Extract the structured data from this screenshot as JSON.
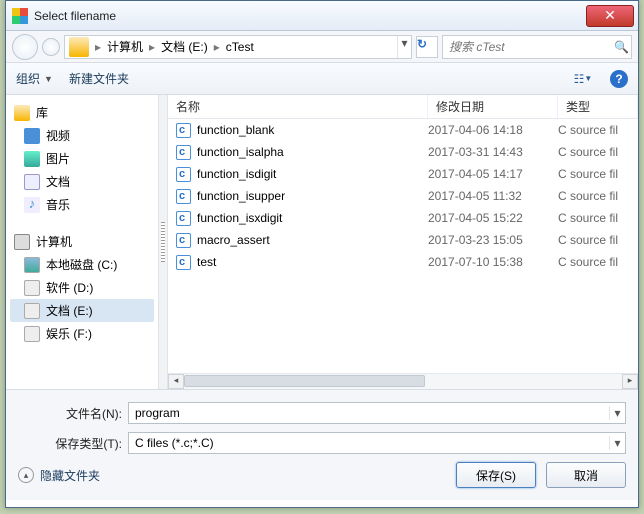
{
  "title": "Select filename",
  "breadcrumb": {
    "seg1": "计算机",
    "seg2": "文档 (E:)",
    "seg3": "cTest"
  },
  "search_placeholder": "搜索 cTest",
  "toolbar": {
    "organize": "组织",
    "newfolder": "新建文件夹"
  },
  "sidebar": {
    "lib": "库",
    "video": "视频",
    "pic": "图片",
    "doc": "文档",
    "music": "音乐",
    "pc": "计算机",
    "drive_c": "本地磁盘 (C:)",
    "drive_d": "软件 (D:)",
    "drive_e": "文档 (E:)",
    "drive_f": "娱乐 (F:)"
  },
  "columns": {
    "name": "名称",
    "date": "修改日期",
    "type": "类型"
  },
  "files": [
    {
      "name": "function_blank",
      "date": "2017-04-06 14:18",
      "type": "C source fil"
    },
    {
      "name": "function_isalpha",
      "date": "2017-03-31 14:43",
      "type": "C source fil"
    },
    {
      "name": "function_isdigit",
      "date": "2017-04-05 14:17",
      "type": "C source fil"
    },
    {
      "name": "function_isupper",
      "date": "2017-04-05 11:32",
      "type": "C source fil"
    },
    {
      "name": "function_isxdigit",
      "date": "2017-04-05 15:22",
      "type": "C source fil"
    },
    {
      "name": "macro_assert",
      "date": "2017-03-23 15:05",
      "type": "C source fil"
    },
    {
      "name": "test",
      "date": "2017-07-10 15:38",
      "type": "C source fil"
    }
  ],
  "form": {
    "filename_label": "文件名(N):",
    "filename_value": "program",
    "filetype_label": "保存类型(T):",
    "filetype_value": "C files (*.c;*.C)"
  },
  "actions": {
    "hide": "隐藏文件夹",
    "save": "保存(S)",
    "cancel": "取消"
  }
}
